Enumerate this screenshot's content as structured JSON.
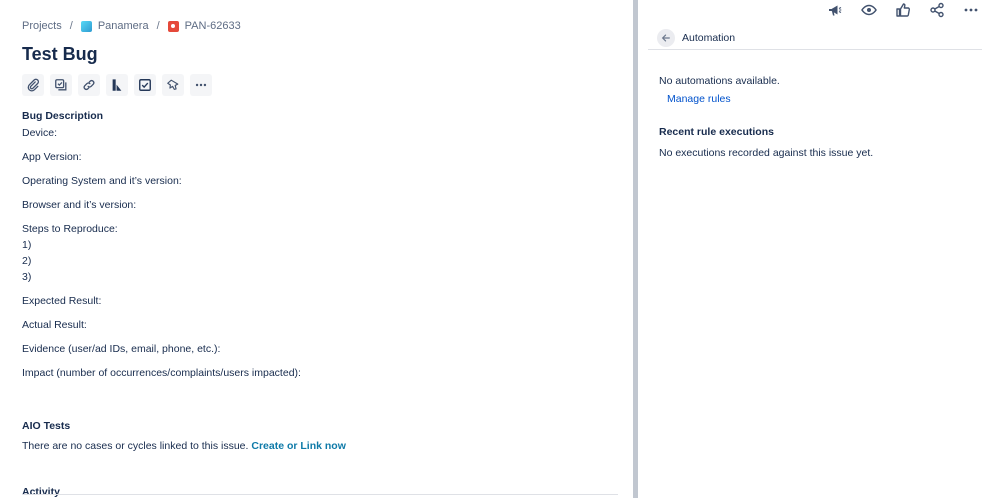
{
  "breadcrumb": {
    "projects": "Projects",
    "separator": "/",
    "project": "Panamera",
    "issue_key": "PAN-62633"
  },
  "issue": {
    "title": "Test Bug"
  },
  "toolbar_icons": [
    "attachment-icon",
    "child-issue-icon",
    "link-icon",
    "confluence-icon",
    "checklist-icon",
    "pin-icon",
    "more-icon"
  ],
  "description": {
    "heading": "Bug Description",
    "device": "Device:",
    "app_version": "App Version:",
    "os": "Operating System and it’s version:",
    "browser": "Browser and it’s version:",
    "steps": "Steps to Reproduce:",
    "step1": "1)",
    "step2": "2)",
    "step3": "3)",
    "expected": "Expected Result:",
    "actual": "Actual Result:",
    "evidence": "Evidence (user/ad IDs, email, phone, etc.):",
    "impact": "Impact (number of occurrences/complaints/users impacted):"
  },
  "aio": {
    "heading": "AIO Tests",
    "text": "There are no cases or cycles linked to this issue.",
    "link": "Create or Link now"
  },
  "activity": {
    "heading": "Activity"
  },
  "panel": {
    "title": "Automation",
    "no_automations": "No automations available.",
    "manage_rules": "Manage rules",
    "recent_heading": "Recent rule executions",
    "recent_text": "No executions recorded against this issue yet."
  },
  "colors": {
    "text": "#172b4d",
    "link": "#0052cc",
    "aio_link": "#0e7aa8",
    "bug": "#e5493a"
  }
}
